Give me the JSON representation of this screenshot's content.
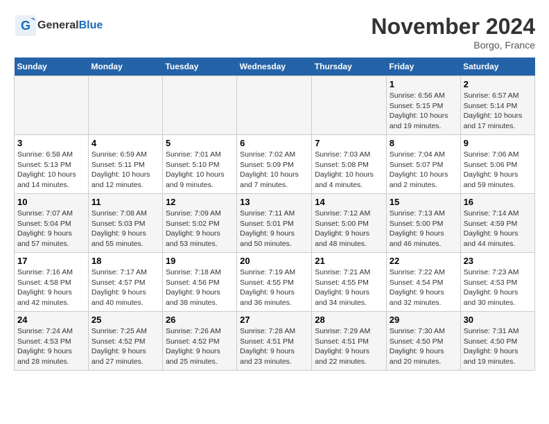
{
  "logo": {
    "text_general": "General",
    "text_blue": "Blue"
  },
  "title": "November 2024",
  "location": "Borgo, France",
  "days_of_week": [
    "Sunday",
    "Monday",
    "Tuesday",
    "Wednesday",
    "Thursday",
    "Friday",
    "Saturday"
  ],
  "weeks": [
    [
      {
        "day": "",
        "info": ""
      },
      {
        "day": "",
        "info": ""
      },
      {
        "day": "",
        "info": ""
      },
      {
        "day": "",
        "info": ""
      },
      {
        "day": "",
        "info": ""
      },
      {
        "day": "1",
        "info": "Sunrise: 6:56 AM\nSunset: 5:15 PM\nDaylight: 10 hours and 19 minutes."
      },
      {
        "day": "2",
        "info": "Sunrise: 6:57 AM\nSunset: 5:14 PM\nDaylight: 10 hours and 17 minutes."
      }
    ],
    [
      {
        "day": "3",
        "info": "Sunrise: 6:58 AM\nSunset: 5:13 PM\nDaylight: 10 hours and 14 minutes."
      },
      {
        "day": "4",
        "info": "Sunrise: 6:59 AM\nSunset: 5:11 PM\nDaylight: 10 hours and 12 minutes."
      },
      {
        "day": "5",
        "info": "Sunrise: 7:01 AM\nSunset: 5:10 PM\nDaylight: 10 hours and 9 minutes."
      },
      {
        "day": "6",
        "info": "Sunrise: 7:02 AM\nSunset: 5:09 PM\nDaylight: 10 hours and 7 minutes."
      },
      {
        "day": "7",
        "info": "Sunrise: 7:03 AM\nSunset: 5:08 PM\nDaylight: 10 hours and 4 minutes."
      },
      {
        "day": "8",
        "info": "Sunrise: 7:04 AM\nSunset: 5:07 PM\nDaylight: 10 hours and 2 minutes."
      },
      {
        "day": "9",
        "info": "Sunrise: 7:06 AM\nSunset: 5:06 PM\nDaylight: 9 hours and 59 minutes."
      }
    ],
    [
      {
        "day": "10",
        "info": "Sunrise: 7:07 AM\nSunset: 5:04 PM\nDaylight: 9 hours and 57 minutes."
      },
      {
        "day": "11",
        "info": "Sunrise: 7:08 AM\nSunset: 5:03 PM\nDaylight: 9 hours and 55 minutes."
      },
      {
        "day": "12",
        "info": "Sunrise: 7:09 AM\nSunset: 5:02 PM\nDaylight: 9 hours and 53 minutes."
      },
      {
        "day": "13",
        "info": "Sunrise: 7:11 AM\nSunset: 5:01 PM\nDaylight: 9 hours and 50 minutes."
      },
      {
        "day": "14",
        "info": "Sunrise: 7:12 AM\nSunset: 5:00 PM\nDaylight: 9 hours and 48 minutes."
      },
      {
        "day": "15",
        "info": "Sunrise: 7:13 AM\nSunset: 5:00 PM\nDaylight: 9 hours and 46 minutes."
      },
      {
        "day": "16",
        "info": "Sunrise: 7:14 AM\nSunset: 4:59 PM\nDaylight: 9 hours and 44 minutes."
      }
    ],
    [
      {
        "day": "17",
        "info": "Sunrise: 7:16 AM\nSunset: 4:58 PM\nDaylight: 9 hours and 42 minutes."
      },
      {
        "day": "18",
        "info": "Sunrise: 7:17 AM\nSunset: 4:57 PM\nDaylight: 9 hours and 40 minutes."
      },
      {
        "day": "19",
        "info": "Sunrise: 7:18 AM\nSunset: 4:56 PM\nDaylight: 9 hours and 38 minutes."
      },
      {
        "day": "20",
        "info": "Sunrise: 7:19 AM\nSunset: 4:55 PM\nDaylight: 9 hours and 36 minutes."
      },
      {
        "day": "21",
        "info": "Sunrise: 7:21 AM\nSunset: 4:55 PM\nDaylight: 9 hours and 34 minutes."
      },
      {
        "day": "22",
        "info": "Sunrise: 7:22 AM\nSunset: 4:54 PM\nDaylight: 9 hours and 32 minutes."
      },
      {
        "day": "23",
        "info": "Sunrise: 7:23 AM\nSunset: 4:53 PM\nDaylight: 9 hours and 30 minutes."
      }
    ],
    [
      {
        "day": "24",
        "info": "Sunrise: 7:24 AM\nSunset: 4:53 PM\nDaylight: 9 hours and 28 minutes."
      },
      {
        "day": "25",
        "info": "Sunrise: 7:25 AM\nSunset: 4:52 PM\nDaylight: 9 hours and 27 minutes."
      },
      {
        "day": "26",
        "info": "Sunrise: 7:26 AM\nSunset: 4:52 PM\nDaylight: 9 hours and 25 minutes."
      },
      {
        "day": "27",
        "info": "Sunrise: 7:28 AM\nSunset: 4:51 PM\nDaylight: 9 hours and 23 minutes."
      },
      {
        "day": "28",
        "info": "Sunrise: 7:29 AM\nSunset: 4:51 PM\nDaylight: 9 hours and 22 minutes."
      },
      {
        "day": "29",
        "info": "Sunrise: 7:30 AM\nSunset: 4:50 PM\nDaylight: 9 hours and 20 minutes."
      },
      {
        "day": "30",
        "info": "Sunrise: 7:31 AM\nSunset: 4:50 PM\nDaylight: 9 hours and 19 minutes."
      }
    ]
  ]
}
